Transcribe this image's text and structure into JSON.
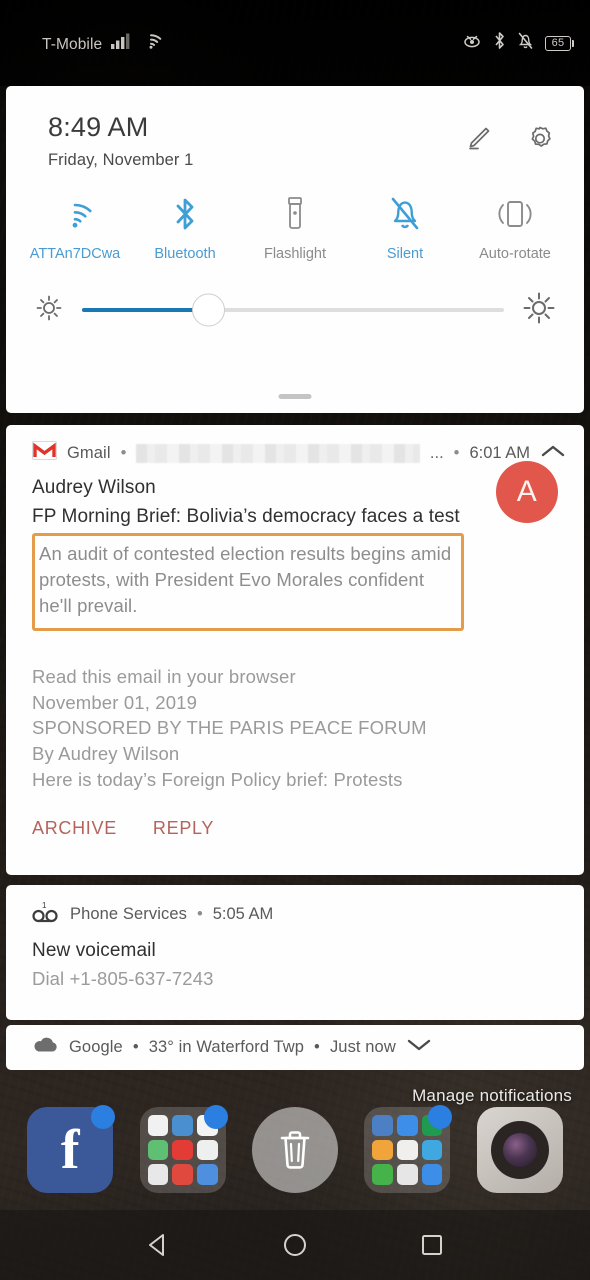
{
  "status_bar": {
    "carrier": "T-Mobile",
    "signal_icon": "cellular-signal-icon",
    "wifi_icon": "wifi-icon",
    "eye_off_icon": "eye-off-icon",
    "bluetooth_icon": "bluetooth-icon",
    "silent_icon": "bell-off-icon",
    "battery_level": "65"
  },
  "quick_settings": {
    "time": "8:49 AM",
    "date": "Friday, November 1",
    "edit_icon": "edit-pencil-icon",
    "settings_icon": "gear-icon",
    "toggles": [
      {
        "label": "ATTAn7DCwa",
        "icon": "wifi-icon",
        "active": true
      },
      {
        "label": "Bluetooth",
        "icon": "bluetooth-icon",
        "active": true
      },
      {
        "label": "Flashlight",
        "icon": "flashlight-icon",
        "active": false
      },
      {
        "label": "Silent",
        "icon": "bell-off-icon",
        "active": false
      },
      {
        "label": "Auto-rotate",
        "icon": "auto-rotate-icon",
        "active": false
      }
    ],
    "brightness": {
      "low_icon": "brightness-low-icon",
      "high_icon": "brightness-high-icon",
      "value_percent": 30
    }
  },
  "notifications": [
    {
      "app": "Gmail",
      "app_icon": "gmail-icon",
      "account_redacted": true,
      "ellipsis": "...",
      "separator": "•",
      "time": "6:01 AM",
      "collapse_icon": "chevron-up-icon",
      "sender": "Audrey Wilson",
      "subject": "FP Morning Brief: Bolivia’s democracy faces a test",
      "snippet": "An audit of contested election results begins amid protests, with President Evo Morales confident he'll prevail.",
      "snippet_highlighted": true,
      "avatar_letter": "A",
      "avatar_color": "#e2574c",
      "highlight_color": "#e59c4a",
      "expanded_lines": [
        "Read this email in your browser",
        "November 01, 2019",
        "SPONSORED BY THE PARIS PEACE FORUM",
        "By Audrey Wilson",
        "Here is today’s Foreign Policy brief: Protests"
      ],
      "actions": [
        "ARCHIVE",
        "REPLY"
      ],
      "action_color": "#b5635c"
    },
    {
      "app": "Phone Services",
      "app_icon": "voicemail-icon",
      "badge_count": "1",
      "separator": "•",
      "time": "5:05 AM",
      "title": "New voicemail",
      "subtitle": "Dial +1-805-637-7243"
    },
    {
      "app": "Google",
      "app_icon": "cloud-icon",
      "separator": "•",
      "summary": "33° in Waterford Twp",
      "time": "Just now",
      "expand_icon": "chevron-down-icon"
    }
  ],
  "manage_notifications_label": "Manage notifications",
  "dock": [
    {
      "name": "facebook",
      "icon": "facebook-icon",
      "glyph": "f",
      "badge": true
    },
    {
      "name": "google-folder",
      "icon": "app-folder-icon",
      "badge": true
    },
    {
      "name": "trash-target",
      "icon": "trash-icon",
      "badge": false
    },
    {
      "name": "social-folder",
      "icon": "app-folder-icon",
      "badge": true
    },
    {
      "name": "camera",
      "icon": "camera-icon",
      "badge": false
    }
  ],
  "nav_bar": {
    "back_icon": "back-triangle-icon",
    "home_icon": "home-circle-icon",
    "recents_icon": "recents-square-icon"
  }
}
